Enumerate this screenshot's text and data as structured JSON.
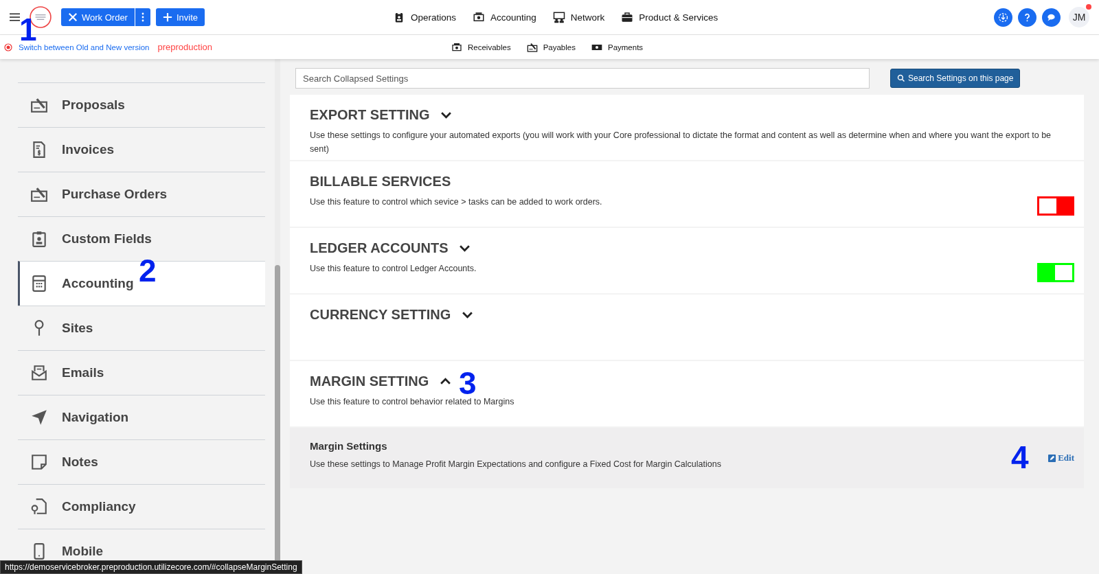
{
  "header": {
    "buttons": [
      {
        "label": "Work Order",
        "kind": "work"
      },
      {
        "label": "Invite",
        "kind": "invite"
      }
    ],
    "nav": [
      {
        "label": "Operations"
      },
      {
        "label": "Accounting"
      },
      {
        "label": "Network"
      },
      {
        "label": "Product & Services"
      }
    ],
    "avatar": "JM",
    "notification": true
  },
  "subbar": {
    "switch_link": "Switch between Old and New version",
    "environment": "preproduction",
    "nav": [
      {
        "label": "Receivables"
      },
      {
        "label": "Payables"
      },
      {
        "label": "Payments"
      }
    ]
  },
  "sidebar": {
    "items": [
      {
        "label": "Proposals",
        "selected": false
      },
      {
        "label": "Invoices",
        "selected": false
      },
      {
        "label": "Purchase Orders",
        "selected": false
      },
      {
        "label": "Custom Fields",
        "selected": false
      },
      {
        "label": "Accounting",
        "selected": true
      },
      {
        "label": "Sites",
        "selected": false
      },
      {
        "label": "Emails",
        "selected": false
      },
      {
        "label": "Navigation",
        "selected": false
      },
      {
        "label": "Notes",
        "selected": false
      },
      {
        "label": "Compliancy",
        "selected": false
      },
      {
        "label": "Mobile",
        "selected": false
      }
    ]
  },
  "search": {
    "placeholder": "Search Collapsed Settings",
    "button": "Search Settings on this page"
  },
  "sections": [
    {
      "title": "EXPORT SETTING",
      "expanded": false,
      "description": "Use these settings to configure your automated exports (you will work with your Core professional to dictate the format and content as well as determine when and where you want the export to be sent)"
    },
    {
      "title": "BILLABLE SERVICES",
      "description": "Use this feature to control which sevice > tasks can be added to work orders.",
      "toggle": {
        "on": false
      }
    },
    {
      "title": "LEDGER ACCOUNTS",
      "expanded": false,
      "description": "Use this feature to control Ledger Accounts.",
      "toggle": {
        "on": true
      }
    },
    {
      "title": "CURRENCY SETTING",
      "expanded": false
    },
    {
      "title": "MARGIN SETTING",
      "expanded": true,
      "description": "Use this feature to control behavior related to Margins"
    }
  ],
  "margin_panel": {
    "title": "Margin Settings",
    "description": "Use these settings to Manage Profit Margin Expectations and configure a Fixed Cost for Margin Calculations",
    "edit": "Edit"
  },
  "annotations": [
    "1",
    "2",
    "3",
    "4"
  ],
  "status_url": "https://demoservicebroker.preproduction.utilizecore.com/#collapseMarginSetting"
}
